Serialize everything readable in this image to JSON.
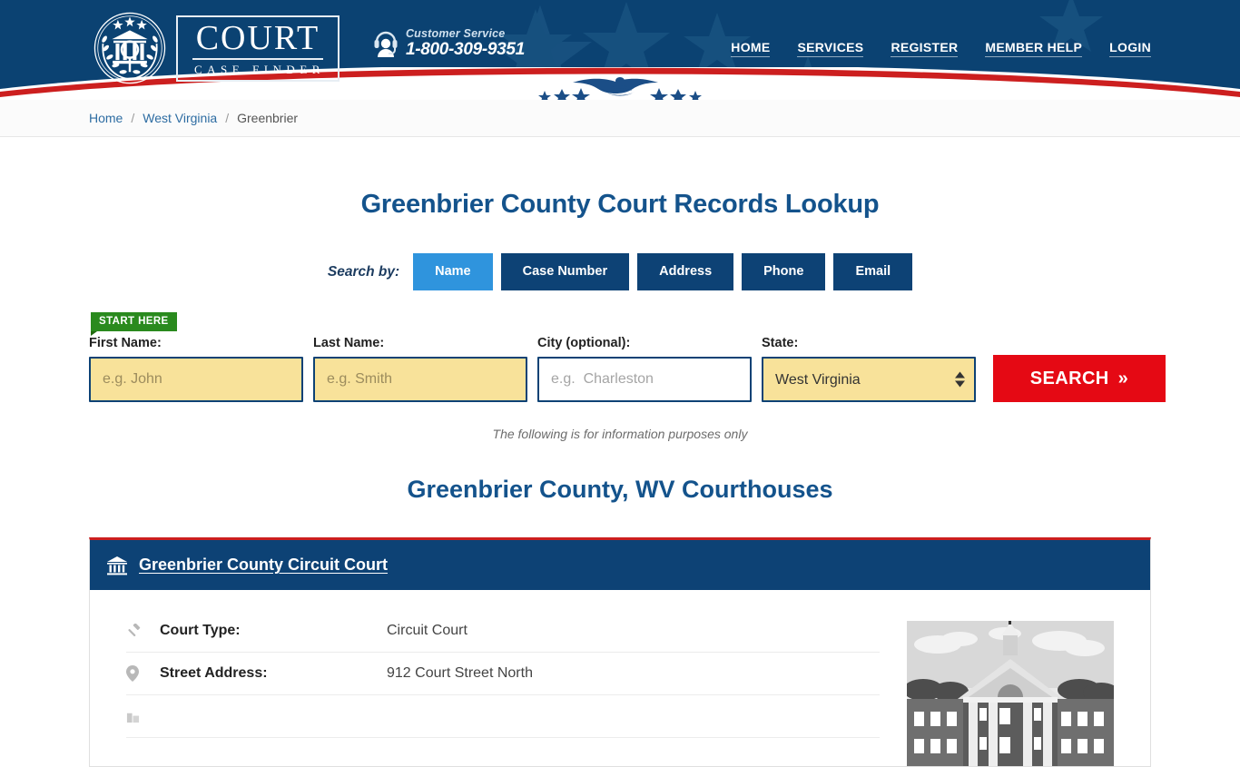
{
  "header": {
    "logo": {
      "title": "COURT",
      "subtitle": "CASE FINDER",
      "seal_icon": "court-seal-icon"
    },
    "customer_service": {
      "label": "Customer Service",
      "phone": "1-800-309-9351",
      "icon": "headset-support-icon"
    },
    "nav": [
      {
        "label": "HOME"
      },
      {
        "label": "SERVICES"
      },
      {
        "label": "REGISTER"
      },
      {
        "label": "MEMBER HELP"
      },
      {
        "label": "LOGIN"
      }
    ],
    "colors": {
      "navy": "#0b4272",
      "red": "#cc1f1f",
      "accent_blue": "#2f94dd"
    }
  },
  "breadcrumb": {
    "items": [
      {
        "label": "Home",
        "current": false
      },
      {
        "label": "West Virginia",
        "current": false
      },
      {
        "label": "Greenbrier",
        "current": true
      }
    ],
    "separator": "/"
  },
  "main": {
    "title": "Greenbrier County Court Records Lookup",
    "search_by_label": "Search by:",
    "tabs": [
      {
        "label": "Name",
        "active": true
      },
      {
        "label": "Case Number",
        "active": false
      },
      {
        "label": "Address",
        "active": false
      },
      {
        "label": "Phone",
        "active": false
      },
      {
        "label": "Email",
        "active": false
      }
    ],
    "start_here_badge": "START HERE",
    "form": {
      "first_name": {
        "label": "First Name:",
        "placeholder": "e.g. John",
        "value": ""
      },
      "last_name": {
        "label": "Last Name:",
        "placeholder": "e.g. Smith",
        "value": ""
      },
      "city": {
        "label": "City (optional):",
        "placeholder": "e.g.  Charleston",
        "value": ""
      },
      "state": {
        "label": "State:",
        "value": "West Virginia",
        "options": [
          "West Virginia"
        ]
      },
      "search_button": "SEARCH",
      "search_button_chevron": "»"
    },
    "disclaimer": "The following is for information purposes only",
    "subtitle": "Greenbrier County, WV Courthouses"
  },
  "court_card": {
    "name": "Greenbrier County Circuit Court",
    "icon": "courthouse-bank-icon",
    "details": [
      {
        "icon": "gavel-icon",
        "key": "Court Type:",
        "value": "Circuit Court"
      },
      {
        "icon": "map-pin-icon",
        "key": "Street Address:",
        "value": "912 Court Street North"
      }
    ],
    "thumbnail_alt": "Greenbrier County Courthouse photo"
  }
}
